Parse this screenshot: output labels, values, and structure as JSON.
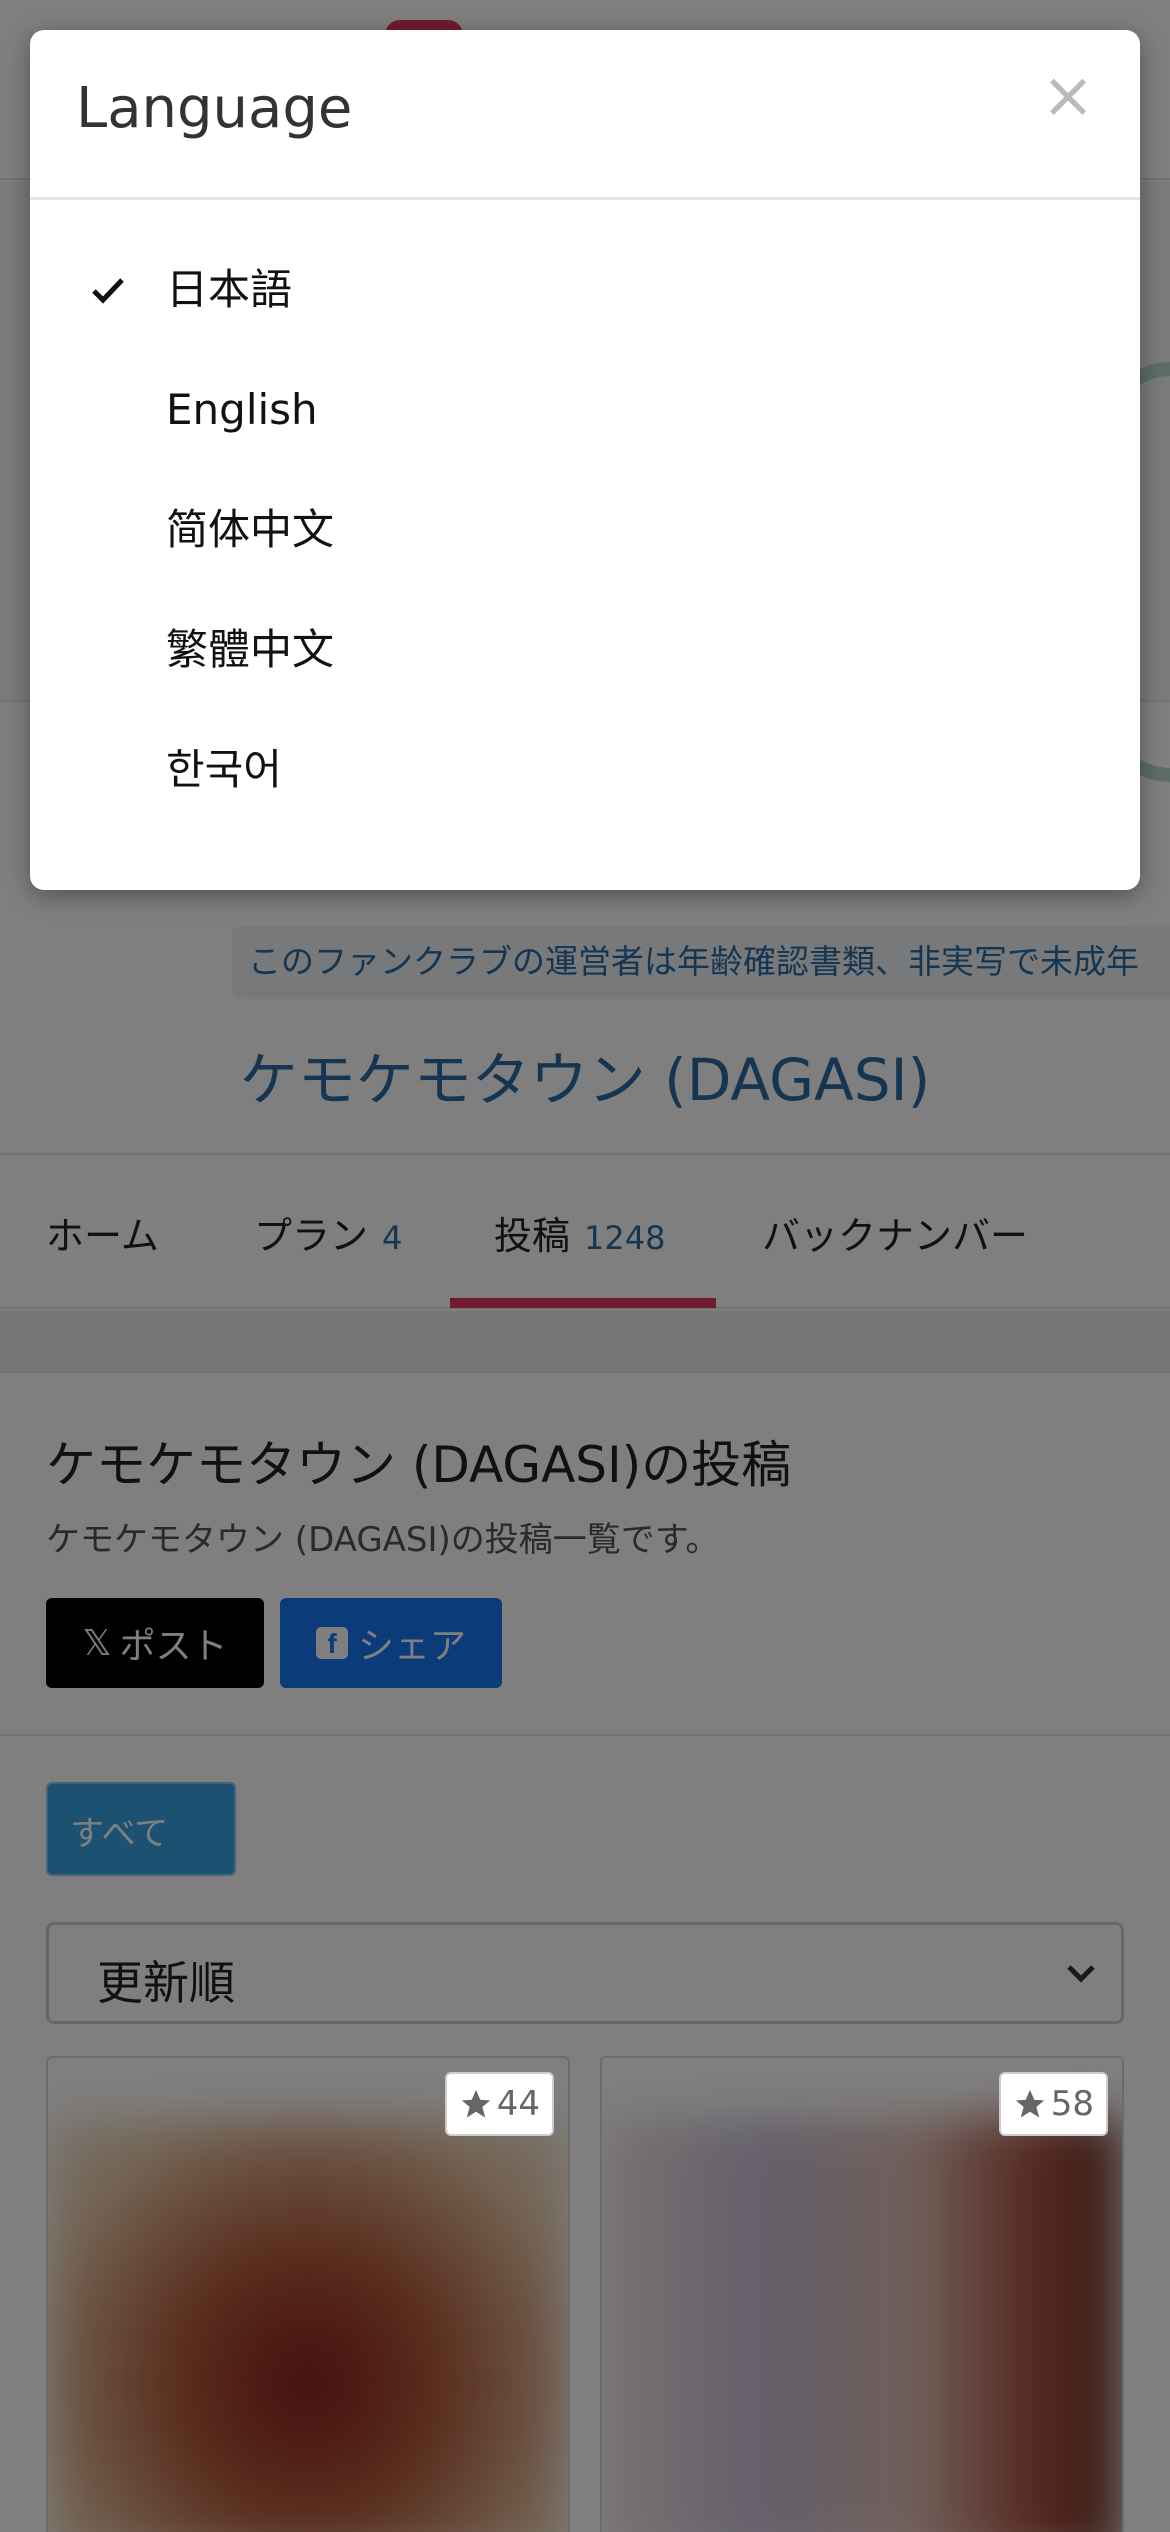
{
  "modal": {
    "title": "Language",
    "close_symbol": "×",
    "selected": "日本語",
    "options": [
      "日本語",
      "English",
      "简体中文",
      "繁體中文",
      "한국어"
    ]
  },
  "page": {
    "notice_text": "このファンクラブの運営者は年齢確認書類、非実写で未成年",
    "club_name": "ケモケモタウン (DAGASI)",
    "tabs": [
      {
        "label": "ホーム",
        "count": ""
      },
      {
        "label": "プラン",
        "count": "4"
      },
      {
        "label": "投稿",
        "count": "1248"
      },
      {
        "label": "バックナンバー",
        "count": ""
      }
    ],
    "section_title": "ケモケモタウン (DAGASI)の投稿",
    "section_subtitle": "ケモケモタウン (DAGASI)の投稿一覧です。",
    "share": {
      "x_label": "ポスト",
      "x_glyph": "𝕏",
      "fb_label": "シェア",
      "fb_glyph": "f"
    },
    "filter_all_label": "すべて",
    "sort_value": "更新順",
    "cards": [
      {
        "favorites": "44"
      },
      {
        "favorites": "58"
      }
    ]
  },
  "colors": {
    "accent_pink": "#e0375f",
    "link_blue": "#2a6aa0",
    "facebook_blue": "#1877f2",
    "filter_blue": "#3ba3e4"
  },
  "icons": {
    "close": "close-icon",
    "check": "check-icon",
    "star": "star-icon",
    "chevron": "chevron-down-icon"
  }
}
